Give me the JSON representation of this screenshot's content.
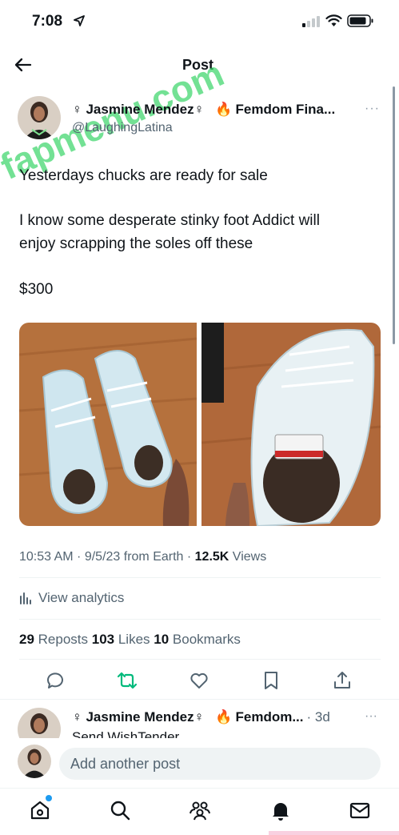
{
  "status_bar": {
    "time": "7:08"
  },
  "header": {
    "title": "Post"
  },
  "watermark": "fapmenu.com",
  "post": {
    "author_name": "♀ Jasmine Mendez♀",
    "fire_emoji": "🔥",
    "author_extra": "Femdom Fina...",
    "handle": "@LaughingLatina",
    "more": "···",
    "text_lines": [
      "Yesterdays chucks are ready for sale",
      "I know some desperate stinky foot Addict will",
      "enjoy scrapping the soles off these",
      "$300"
    ],
    "time": "10:53 AM · 9/5/23 from Earth · ",
    "views_count": "12.5K",
    "views_label": " Views",
    "analytics_label": "View analytics",
    "reposts_count": "29",
    "reposts_label": " Reposts  ",
    "likes_count": "103",
    "likes_label": " Likes  ",
    "bookmarks_count": "10",
    "bookmarks_label": " Bookmarks"
  },
  "second_post": {
    "author_name": "♀ Jasmine Mendez♀",
    "fire_emoji": "🔥",
    "author_extra": "Femdom...",
    "time": "· 3d",
    "more": "···",
    "text": "Send WishTender"
  },
  "reply": {
    "placeholder": "Add another post"
  },
  "colors": {
    "accent": "#1d9bf0",
    "repost_green": "#00ba7c",
    "text": "#0f1419",
    "muted": "#536471"
  },
  "icons": {
    "back": "arrow-left-icon",
    "reply": "comment-icon",
    "repost": "repost-icon",
    "like": "heart-icon",
    "bookmark": "bookmark-icon",
    "share": "share-icon",
    "analytics": "bar-chart-icon",
    "tabs": [
      "home-icon",
      "search-icon",
      "communities-icon",
      "notifications-icon",
      "messages-icon"
    ]
  }
}
